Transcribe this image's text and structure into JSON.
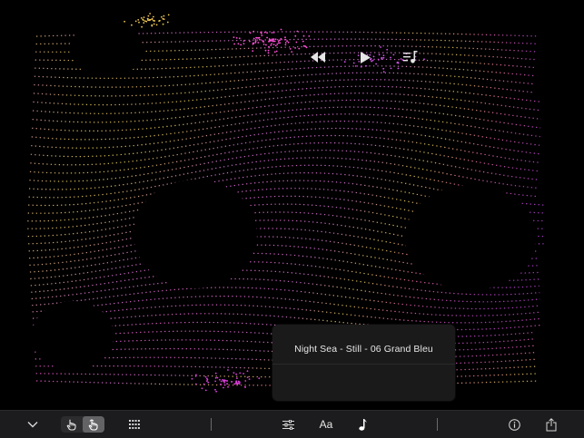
{
  "now_playing": {
    "title": "Night Sea - Still - 06 Grand Bleu"
  },
  "toolbar": {
    "font_label": "Aa",
    "interaction_mode_selected": "second"
  },
  "icons": {
    "collapse": "chevron-down-icon",
    "touch_mode_1": "hand-pointer-icon",
    "touch_mode_2": "hand-pointer-active-icon",
    "grid": "grid-dots-icon",
    "settings": "sliders-icon",
    "font": "font-icon",
    "music": "music-note-icon",
    "info": "info-icon",
    "share": "share-icon",
    "rewind": "rewind-icon",
    "play": "play-icon",
    "queue": "queue-music-icon"
  },
  "colors": {
    "background": "#000000",
    "toolbar": "#1c1c1e",
    "popup": "#1a1a1a",
    "particle_magenta": "#e040e0",
    "particle_pink": "#ff5ab0",
    "particle_yellow": "#e8e04a"
  }
}
